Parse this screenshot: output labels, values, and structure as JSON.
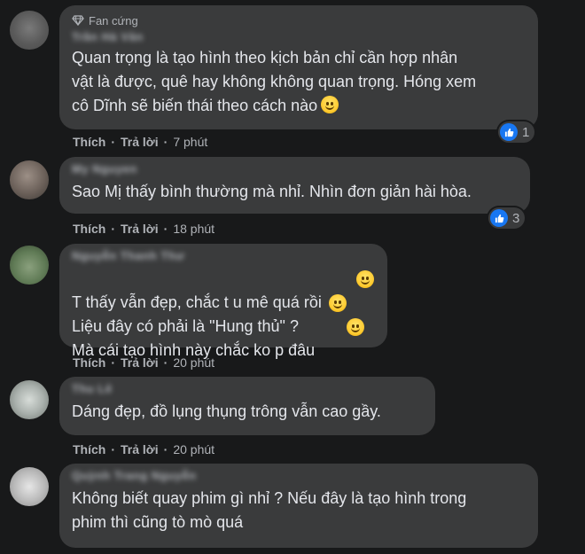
{
  "comments": [
    {
      "badge": "Fan cứng",
      "author": "Trần Hà Vân",
      "lines": "Quan trọng là tạo hình theo kịch bản chỉ cần hợp nhân\nvật là được, quê hay không không quan trọng. Hóng xem\ncô Dĩnh sẽ biến thái theo cách nào",
      "emoji": "thinking-face",
      "reactions": "1",
      "like": "Thích",
      "reply": "Trả lời",
      "time": "7 phút"
    },
    {
      "badge": "",
      "author": "My Nguyen",
      "lines": "Sao Mị thấy bình thường mà nhỉ. Nhìn đơn giản hài hòa.",
      "emoji": "",
      "reactions": "3",
      "like": "Thích",
      "reply": "Trả lời",
      "time": "18 phút"
    },
    {
      "badge": "",
      "author": "Nguyễn Thanh Thư",
      "lines": "T thấy vẫn đẹp, chắc t u mê quá rồi\nLiệu đây có phải là \"Hung thủ\" ?\nMà cái tạo hình này chắc ko p đâu",
      "emoji": "laughing-face",
      "reactions": "",
      "like": "Thích",
      "reply": "Trả lời",
      "time": "20 phút"
    },
    {
      "badge": "",
      "author": "Thu Lê",
      "lines": "Dáng đẹp, đồ lụng thụng trông vẫn cao gầy.",
      "emoji": "",
      "reactions": "",
      "like": "Thích",
      "reply": "Trả lời",
      "time": "20 phút"
    },
    {
      "badge": "",
      "author": "Quỳnh Trang Nguyễn",
      "lines": "Không biết quay phim gì nhỉ ? Nếu đây là tạo hình trong\nphim thì cũng tò mò quá",
      "emoji": "",
      "reactions": "",
      "like": "",
      "reply": "",
      "time": ""
    }
  ]
}
